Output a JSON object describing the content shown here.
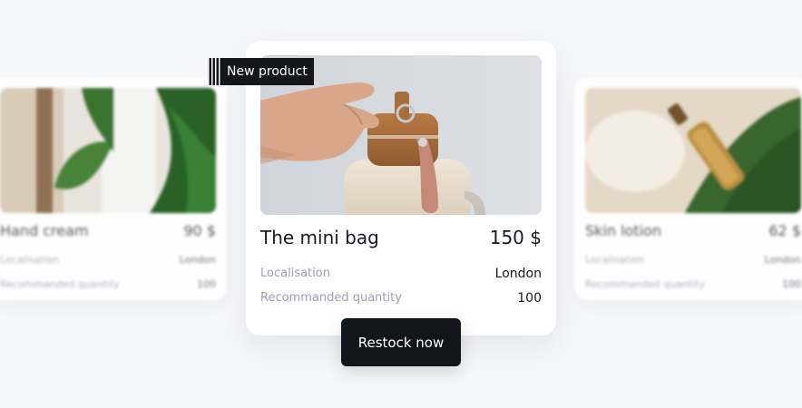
{
  "badge": {
    "label": "New product"
  },
  "left_card": {
    "title": "Hand cream",
    "price": "90 $",
    "rows": [
      {
        "label": "Localisation",
        "value": "London"
      },
      {
        "label": "Recommanded quantity",
        "value": "100"
      }
    ]
  },
  "main_card": {
    "title": "The mini bag",
    "price": "150 $",
    "rows": [
      {
        "label": "Localisation",
        "value": "London"
      },
      {
        "label": "Recommanded quantity",
        "value": "100"
      }
    ]
  },
  "right_card": {
    "title": "Skin lotion",
    "price": "62 $",
    "rows": [
      {
        "label": "Localisation",
        "value": "London"
      },
      {
        "label": "Recommanded quantity",
        "value": "100"
      }
    ]
  },
  "actions": {
    "restock_label": "Restock now"
  },
  "colors": {
    "background": "#f6f7f9",
    "badge_bg": "#14161c",
    "button_bg": "#12151b",
    "muted_text": "#9aa1ad"
  }
}
